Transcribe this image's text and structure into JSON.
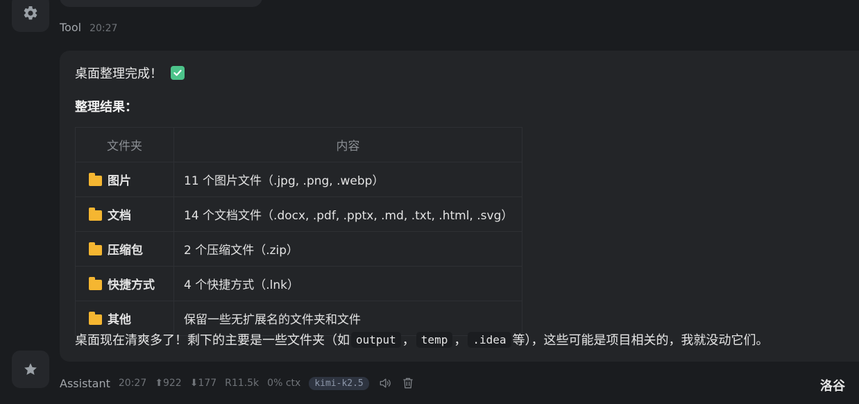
{
  "tool_message": {
    "sender": "Tool",
    "time": "20:27",
    "avatar_icon": "gear-icon"
  },
  "assistant_message": {
    "line1": "桌面整理完成！",
    "status_icon": "check-mark-icon",
    "subtitle": "整理结果：",
    "table": {
      "headers": [
        "文件夹",
        "内容"
      ],
      "folder_icon": "folder-icon",
      "rows": [
        {
          "folder": "图片",
          "content": "11 个图片文件（.jpg, .png, .webp）"
        },
        {
          "folder": "文档",
          "content": "14 个文档文件（.docx, .pdf, .pptx, .md, .txt, .html, .svg）"
        },
        {
          "folder": "压缩包",
          "content": "2 个压缩文件（.zip）"
        },
        {
          "folder": "快捷方式",
          "content": "4 个快捷方式（.lnk）"
        },
        {
          "folder": "其他",
          "content": "保留一些无扩展名的文件夹和文件"
        }
      ]
    },
    "conclusion": {
      "prefix": "桌面现在清爽多了！剩下的主要是一些文件夹（如",
      "codes": [
        "output",
        "temp",
        ".idea"
      ],
      "sep": "，",
      "suffix": "等），这些可能是项目相关的，我就没动它们。"
    }
  },
  "assistant_meta": {
    "sender": "Assistant",
    "time": "20:27",
    "tokens_in": "⬆922",
    "tokens_out": "⬇177",
    "reasoning": "R11.5k",
    "ctx": "0% ctx",
    "model": "kimi-k2.5",
    "avatar_icon": "star-icon",
    "actions": [
      "speaker-icon",
      "trash-icon"
    ]
  },
  "user_name": "洛谷",
  "colors": {
    "background": "#1a1c1f",
    "bubble": "#232528",
    "folder": "#f5b631",
    "check": "#4cc38a",
    "model_badge": "#2e3440"
  }
}
